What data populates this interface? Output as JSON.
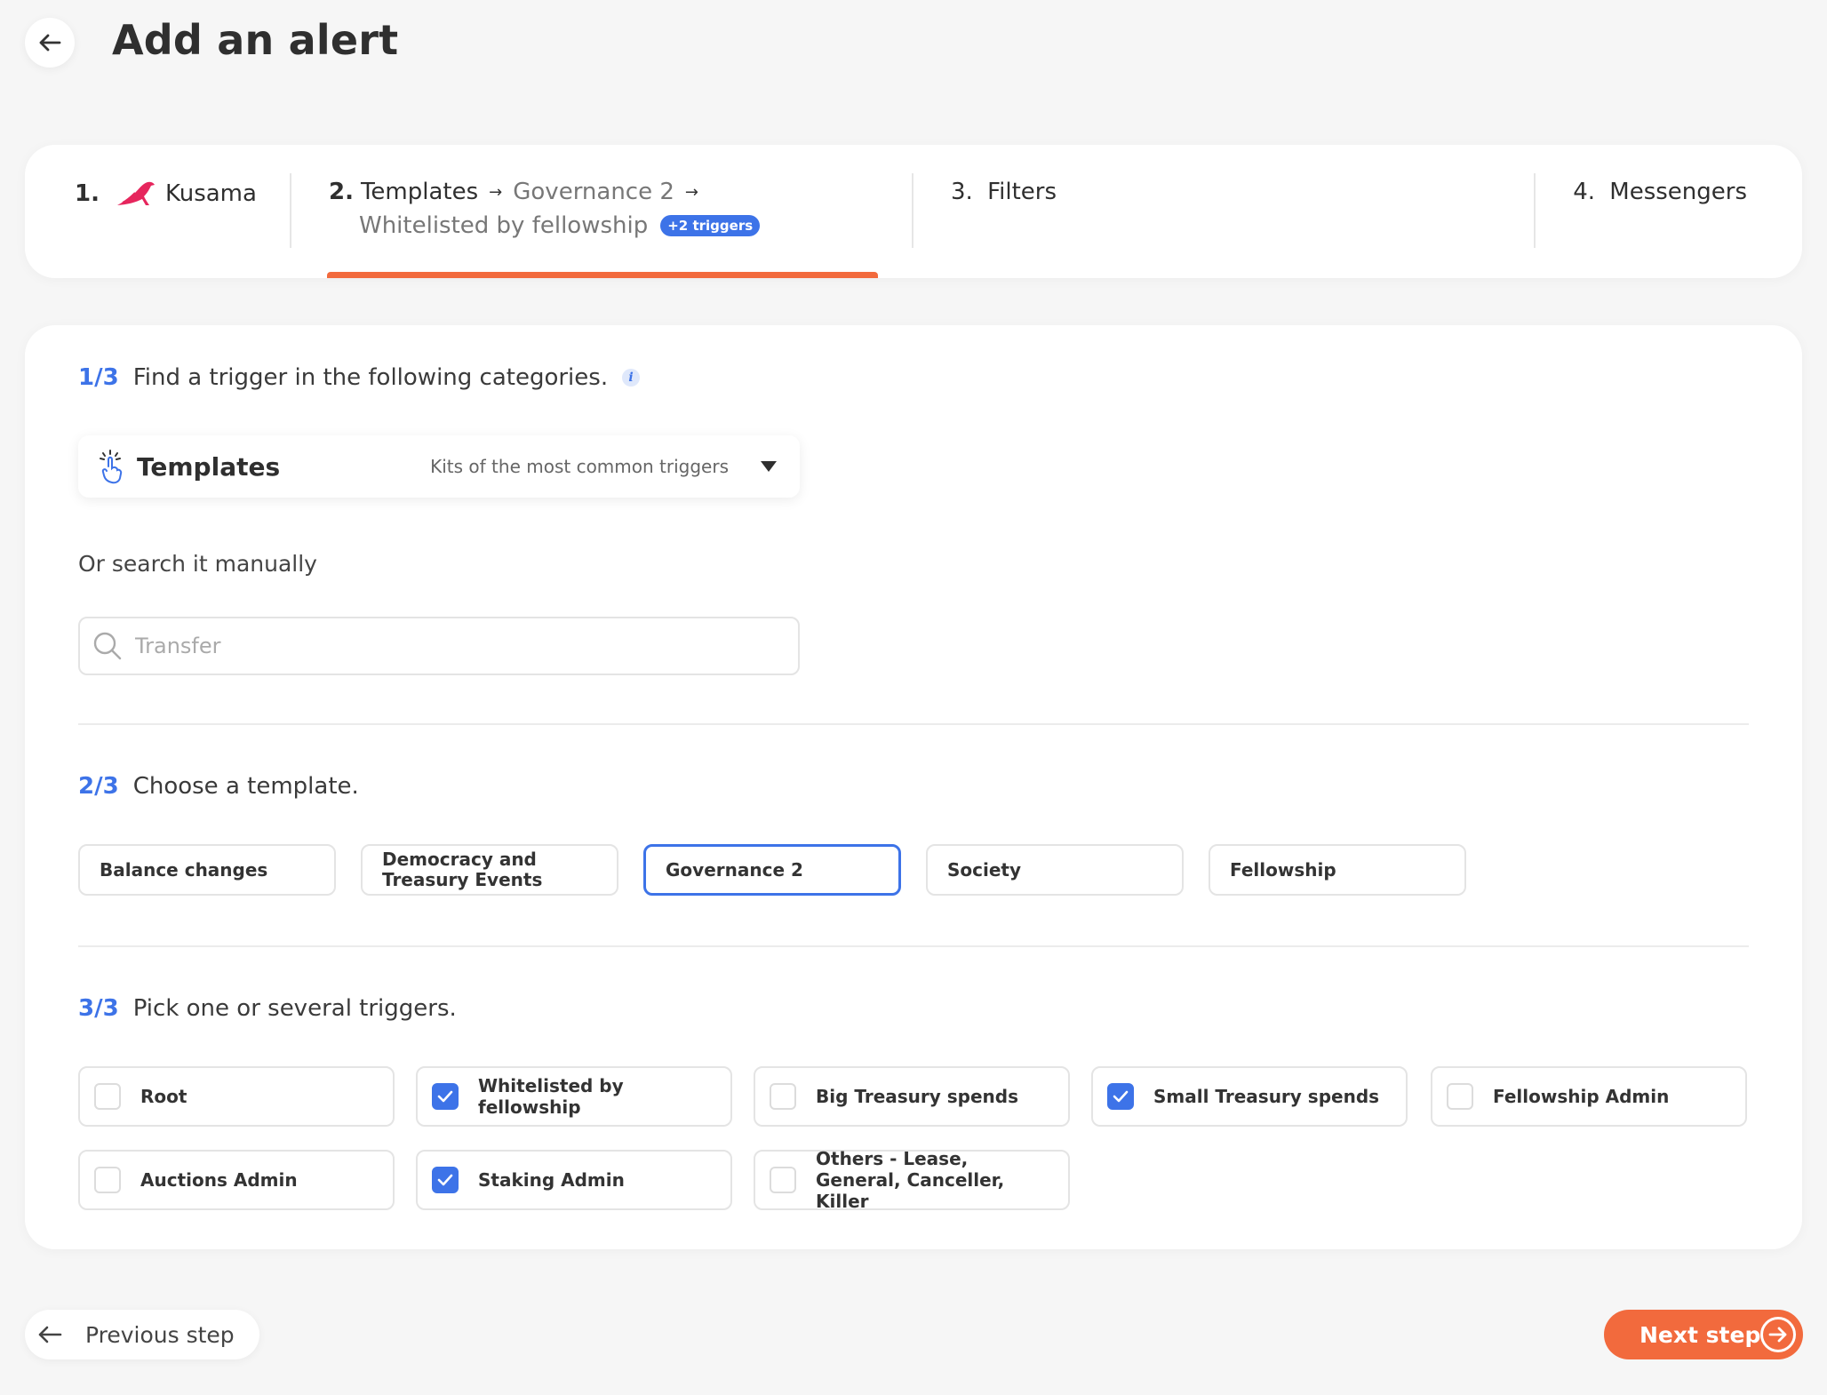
{
  "header": {
    "title": "Add an alert"
  },
  "stepper": {
    "step1": {
      "num": "1.",
      "label": "Kusama"
    },
    "step2": {
      "num": "2.",
      "label": "Templates",
      "path1": "Governance 2",
      "path2": "Whitelisted by fellowship",
      "badge": "+2 triggers"
    },
    "step3": {
      "num": "3.",
      "label": "Filters"
    },
    "step4": {
      "num": "4.",
      "label": "Messengers"
    }
  },
  "section1": {
    "frac": "1/3",
    "label": "Find a trigger in the following categories.",
    "dropdown": {
      "title": "Templates",
      "subtitle": "Kits of the most common triggers"
    },
    "manual_label": "Or search it manually",
    "search": {
      "placeholder": "Transfer",
      "value": ""
    }
  },
  "section2": {
    "frac": "2/3",
    "label": "Choose a template.",
    "templates": [
      {
        "label": "Balance changes",
        "selected": false
      },
      {
        "label": "Democracy and Treasury Events",
        "selected": false
      },
      {
        "label": "Governance 2",
        "selected": true
      },
      {
        "label": "Society",
        "selected": false
      },
      {
        "label": "Fellowship",
        "selected": false
      }
    ]
  },
  "section3": {
    "frac": "3/3",
    "label": "Pick one or several triggers.",
    "triggers": [
      {
        "label": "Root",
        "checked": false
      },
      {
        "label": "Whitelisted by fellowship",
        "checked": true
      },
      {
        "label": "Big Treasury spends",
        "checked": false
      },
      {
        "label": "Small Treasury spends",
        "checked": true
      },
      {
        "label": "Fellowship Admin",
        "checked": false
      },
      {
        "label": "Auctions Admin",
        "checked": false
      },
      {
        "label": "Staking Admin",
        "checked": true
      },
      {
        "label": "Others - Lease, General, Canceller, Killer",
        "checked": false
      }
    ]
  },
  "footer": {
    "prev_label": "Previous step",
    "next_label": "Next step"
  },
  "colors": {
    "accent_blue": "#3d73e8",
    "accent_orange": "#f26a3d",
    "kusama_pink": "#e6265d"
  },
  "icons": {
    "back": "arrow-left-icon",
    "kusama": "kusama-bird-icon",
    "templates": "hand-sparkle-icon",
    "search": "search-icon",
    "info": "info-icon",
    "check": "check-icon",
    "next": "arrow-right-circle-icon"
  }
}
